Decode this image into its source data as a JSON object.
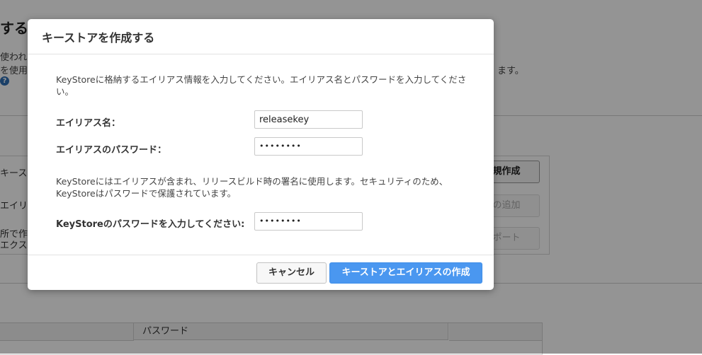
{
  "background": {
    "title_fragment": "する",
    "line1_fragment": "使われて",
    "line2_fragment": "を使用し",
    "line2_right_fragment": "ます。",
    "help_glyph": "?",
    "rows": [
      {
        "label_fragment": "キース",
        "button": "新規作成"
      },
      {
        "label_fragment": "エイリ",
        "button": "スの追加"
      },
      {
        "label_fragment": "所で作",
        "label_fragment2": "エクス",
        "button": "スポート"
      }
    ],
    "table_headers": [
      "",
      "パスワード",
      ""
    ]
  },
  "dialog": {
    "title": "キーストアを作成する",
    "description1": "KeyStoreに格納するエイリアス情報を入力してください。エイリアス名とパスワードを入力してください。",
    "alias_label": "エイリアス名：",
    "alias_value": "releasekey",
    "alias_password_label": "エイリアスのパスワード：",
    "alias_password_value": "••••••••",
    "description2": "KeyStoreにはエイリアスが含まれ、リリースビルド時の署名に使用します。セキュリティのため、KeyStoreはパスワードで保護されています。",
    "keystore_password_label": "KeyStoreのパスワードを入力してください:",
    "keystore_password_value": "••••••••",
    "cancel_label": "キャンセル",
    "create_label": "キーストアとエイリアスの作成"
  },
  "colors": {
    "primary_button": "#4a97f0",
    "overlay": "rgba(0,0,0,0.42)"
  }
}
